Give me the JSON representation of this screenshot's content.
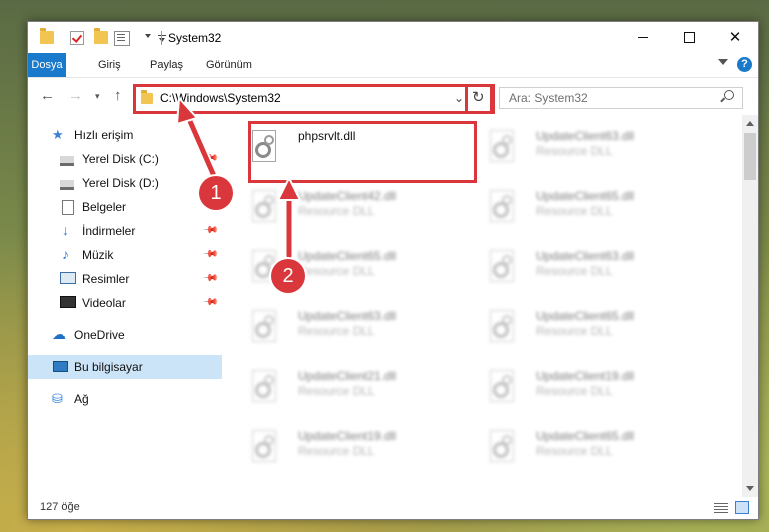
{
  "titlebar": {
    "title": "System32"
  },
  "ribbon": {
    "tabs": [
      "Dosya",
      "Giriş",
      "Paylaş",
      "Görünüm"
    ]
  },
  "navbar": {
    "address": "C:\\Windows\\System32",
    "search_placeholder": "Ara: System32"
  },
  "sidebar": {
    "items": [
      {
        "label": "Hızlı erişim",
        "icon": "star-icon"
      },
      {
        "label": "Yerel Disk (C:)",
        "icon": "drive-icon"
      },
      {
        "label": "Yerel Disk (D:)",
        "icon": "drive-icon"
      },
      {
        "label": "Belgeler",
        "icon": "documents-icon"
      },
      {
        "label": "İndirmeler",
        "icon": "downloads-icon"
      },
      {
        "label": "Müzik",
        "icon": "music-icon"
      },
      {
        "label": "Resimler",
        "icon": "pictures-icon"
      },
      {
        "label": "Videolar",
        "icon": "videos-icon"
      },
      {
        "label": "OneDrive",
        "icon": "onedrive-icon"
      },
      {
        "label": "Bu bilgisayar",
        "icon": "this-pc-icon"
      },
      {
        "label": "Ağ",
        "icon": "network-icon"
      }
    ]
  },
  "files": {
    "highlighted": {
      "name": "phpsrvlt.dll"
    },
    "left": [
      {
        "name": "UpdateClient42.dll",
        "type": "Resource DLL"
      },
      {
        "name": "UpdateClient65.dll",
        "type": "Resource DLL"
      },
      {
        "name": "UpdateClient63.dll",
        "type": "Resource DLL"
      },
      {
        "name": "UpdateClient21.dll",
        "type": "Resource DLL"
      },
      {
        "name": "UpdateClient19.dll",
        "type": "Resource DLL"
      }
    ],
    "right": [
      {
        "name": "UpdateClient63.dll",
        "type": "Resource DLL"
      },
      {
        "name": "UpdateClient65.dll",
        "type": "Resource DLL"
      },
      {
        "name": "UpdateClient63.dll",
        "type": "Resource DLL"
      },
      {
        "name": "UpdateClient65.dll",
        "type": "Resource DLL"
      },
      {
        "name": "UpdateClient19.dll",
        "type": "Resource DLL"
      },
      {
        "name": "UpdateClient65.dll",
        "type": "Resource DLL"
      }
    ]
  },
  "statusbar": {
    "count": "127 öğe"
  },
  "annotations": {
    "step1": "1",
    "step2": "2"
  },
  "colors": {
    "accent": "#1979ca",
    "highlight": "#d9373b"
  }
}
